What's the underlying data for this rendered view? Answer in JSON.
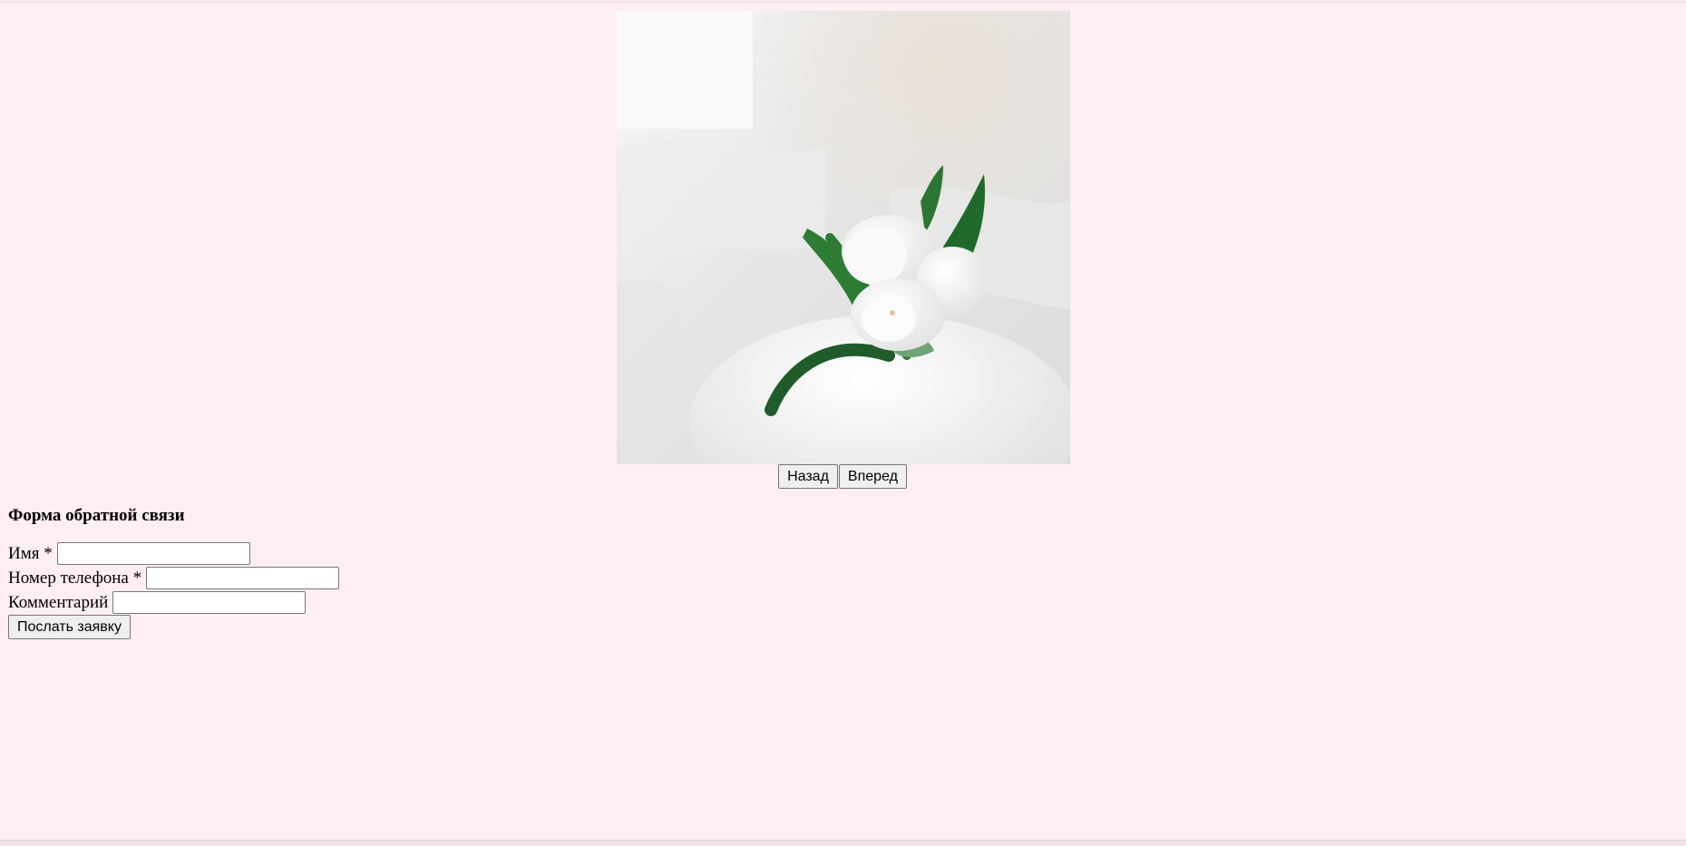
{
  "colors": {
    "page_background": "#ffeef4"
  },
  "slider": {
    "image_subject": "white-tulips-in-vase",
    "prev_label": "Назад",
    "next_label": "Вперед"
  },
  "feedback_form": {
    "title": "Форма обратной связи",
    "fields": [
      {
        "label": "Имя *",
        "value": ""
      },
      {
        "label": "Номер телефона *",
        "value": ""
      },
      {
        "label": "Комментарий",
        "value": ""
      }
    ],
    "submit_label": "Послать заявку"
  }
}
